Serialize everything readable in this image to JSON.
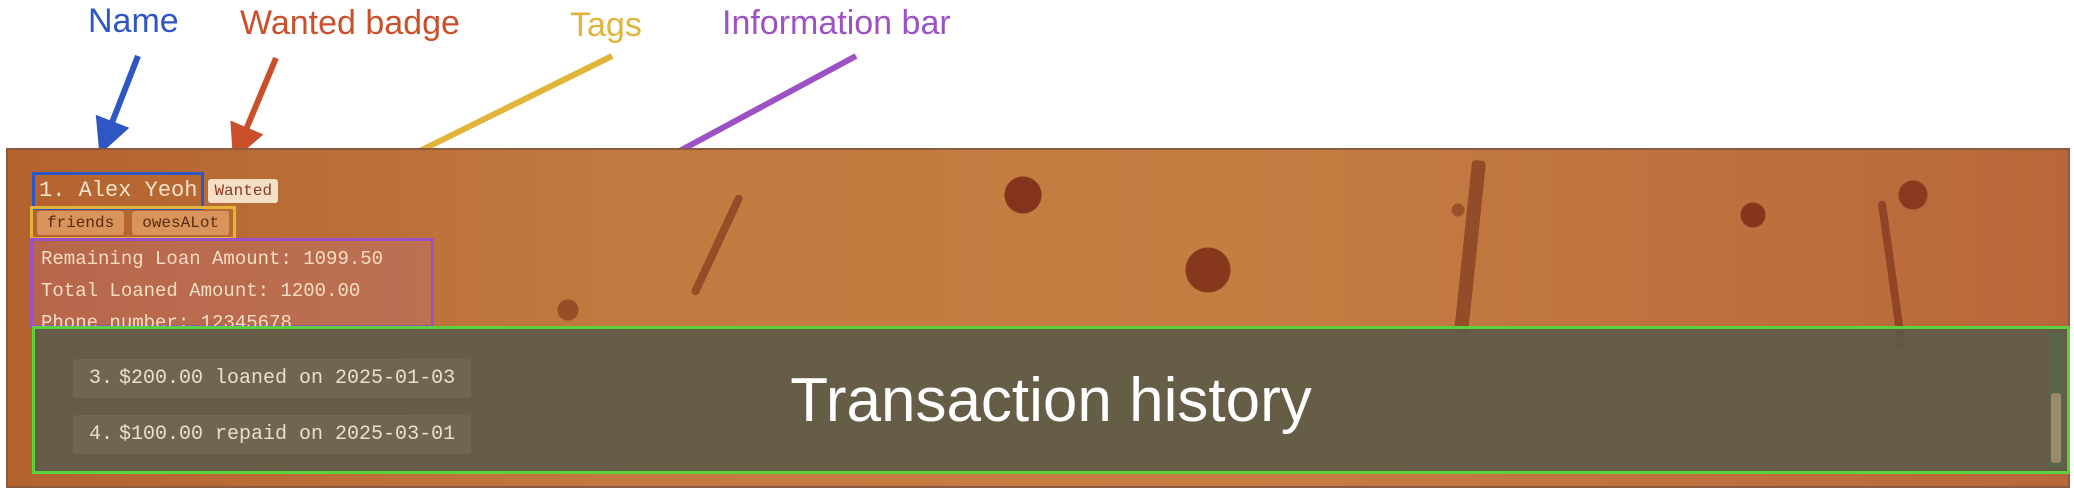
{
  "callouts": {
    "name": "Name",
    "wanted_badge": "Wanted badge",
    "tags": "Tags",
    "information_bar": "Information bar",
    "transaction_history": "Transaction history"
  },
  "colors": {
    "name": "#2e56c4",
    "wanted_badge": "#c9502a",
    "tags": "#e1b43a",
    "information_bar": "#9c51c4",
    "transaction_history": "#5ad23c"
  },
  "person": {
    "index_name": "1. Alex Yeoh",
    "badge": "Wanted",
    "tags": [
      "friends",
      "owesALot"
    ],
    "info": {
      "remaining": "Remaining Loan Amount: 1099.50",
      "total": "Total Loaned Amount: 1200.00",
      "phone": "Phone number: 12345678"
    }
  },
  "transactions": [
    {
      "num": "3.",
      "text": "$200.00 loaned on 2025-01-03"
    },
    {
      "num": "4.",
      "text": "$100.00 repaid on 2025-03-01"
    }
  ]
}
